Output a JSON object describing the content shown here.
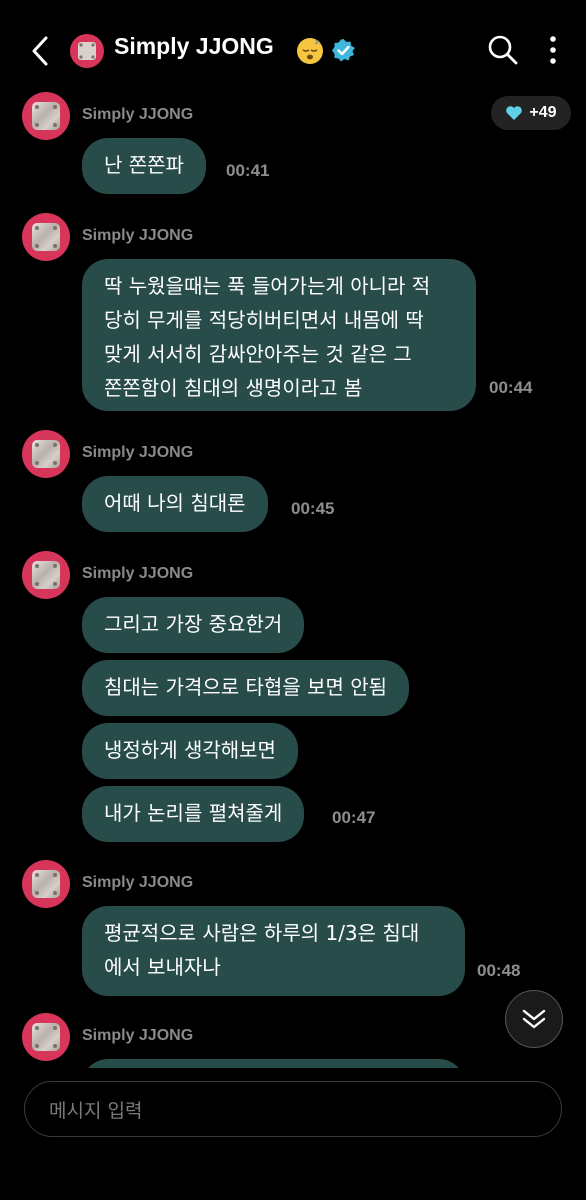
{
  "header": {
    "title": "Simply JJONG",
    "emoji": "😴",
    "back_icon": "chevron-left-icon",
    "search_icon": "search-icon",
    "more_icon": "more-vertical-icon",
    "verified_icon": "verified-badge-icon"
  },
  "reactions": {
    "count": "+49",
    "icon": "heart-icon",
    "color": "#5fd0e6"
  },
  "groups": [
    {
      "sender": "Simply JJONG",
      "messages": [
        {
          "lines": [
            "난 쫀쫀파"
          ]
        }
      ],
      "time": "00:41"
    },
    {
      "sender": "Simply JJONG",
      "messages": [
        {
          "lines": [
            "딱 누웠을때는 푹 들어가는게 아니라 적",
            "당히 무게를 적당히버티면서 내몸에 딱",
            "맞게 서서히 감싸안아주는 것 같은 그",
            "쫀쫀함이 침대의 생명이라고 봄"
          ]
        }
      ],
      "time": "00:44"
    },
    {
      "sender": "Simply JJONG",
      "messages": [
        {
          "lines": [
            "어때 나의 침대론"
          ]
        }
      ],
      "time": "00:45"
    },
    {
      "sender": "Simply JJONG",
      "messages": [
        {
          "lines": [
            "그리고 가장 중요한거"
          ]
        },
        {
          "lines": [
            "침대는 가격으로 타협을 보면 안됨"
          ]
        },
        {
          "lines": [
            "냉정하게 생각해보면"
          ]
        },
        {
          "lines": [
            "내가 논리를 펼쳐줄게"
          ]
        }
      ],
      "time": "00:47"
    },
    {
      "sender": "Simply JJONG",
      "messages": [
        {
          "lines": [
            "평균적으로 사람은 하루의 1/3은 침대",
            "에서 보내자나"
          ]
        }
      ],
      "time": "00:48"
    },
    {
      "sender": "Simply JJONG",
      "messages": [],
      "time": ""
    }
  ],
  "input": {
    "placeholder": "메시지 입력"
  },
  "colors": {
    "bubble": "#274c4a",
    "avatar_ring": "#d8355a",
    "verified": "#3fb6dc",
    "background": "#000000"
  }
}
